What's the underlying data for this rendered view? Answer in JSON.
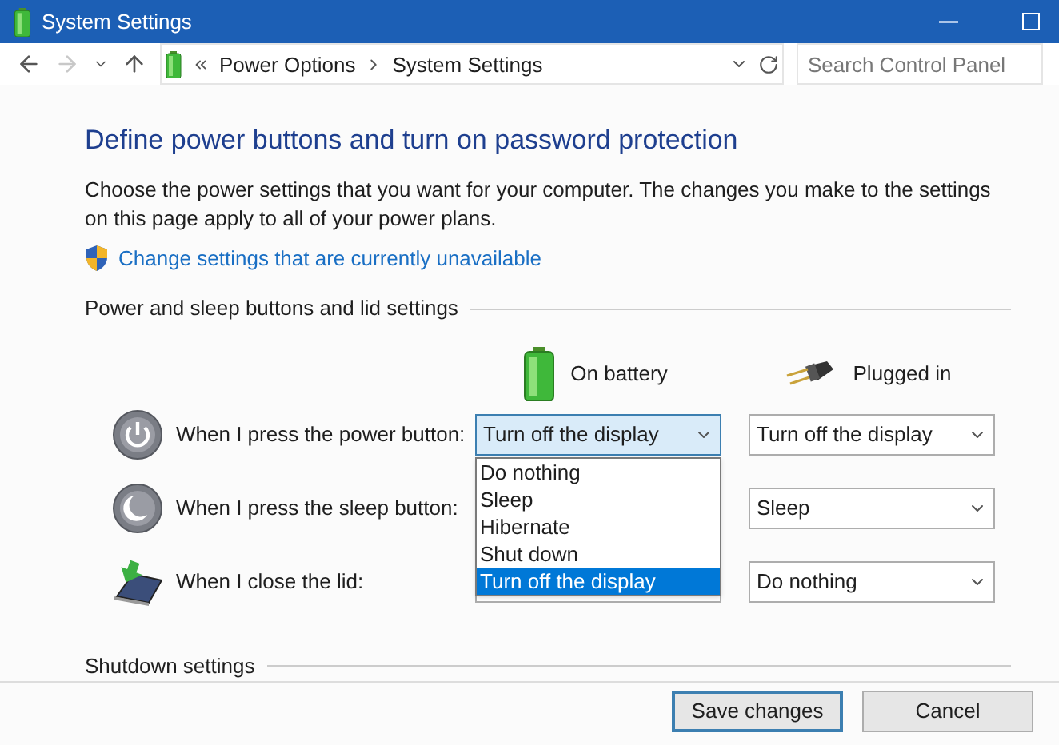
{
  "window": {
    "title": "System Settings"
  },
  "address_bar": {
    "crumbs": [
      "Power Options",
      "System Settings"
    ]
  },
  "search": {
    "placeholder": "Search Control Panel"
  },
  "heading": "Define power buttons and turn on password protection",
  "description": "Choose the power settings that you want for your computer. The changes you make to the settings on this page apply to all of your power plans.",
  "link": "Change settings that are currently unavailable",
  "power_section": {
    "title": "Power and sleep buttons and lid settings",
    "columns": [
      "On battery",
      "Plugged in"
    ],
    "rows": [
      {
        "kind": "power",
        "label": "When I press the power button:",
        "on_battery": "Turn off the display",
        "plugged_in": "Turn off the display",
        "focused": true
      },
      {
        "kind": "sleep",
        "label": "When I press the sleep button:",
        "plugged_in": "Sleep"
      },
      {
        "kind": "lid",
        "label": "When I close the lid:",
        "plugged_in": "Do nothing"
      }
    ]
  },
  "dropdown_menu": {
    "options": [
      {
        "label": "Do nothing",
        "selected": false
      },
      {
        "label": "Sleep",
        "selected": false
      },
      {
        "label": "Hibernate",
        "selected": false
      },
      {
        "label": "Shut down",
        "selected": false
      },
      {
        "label": "Turn off the display",
        "selected": true
      }
    ]
  },
  "shutdown_section": {
    "title": "Shutdown settings"
  },
  "buttons": [
    {
      "label": "Save changes",
      "default": true
    },
    {
      "label": "Cancel",
      "default": false
    }
  ]
}
